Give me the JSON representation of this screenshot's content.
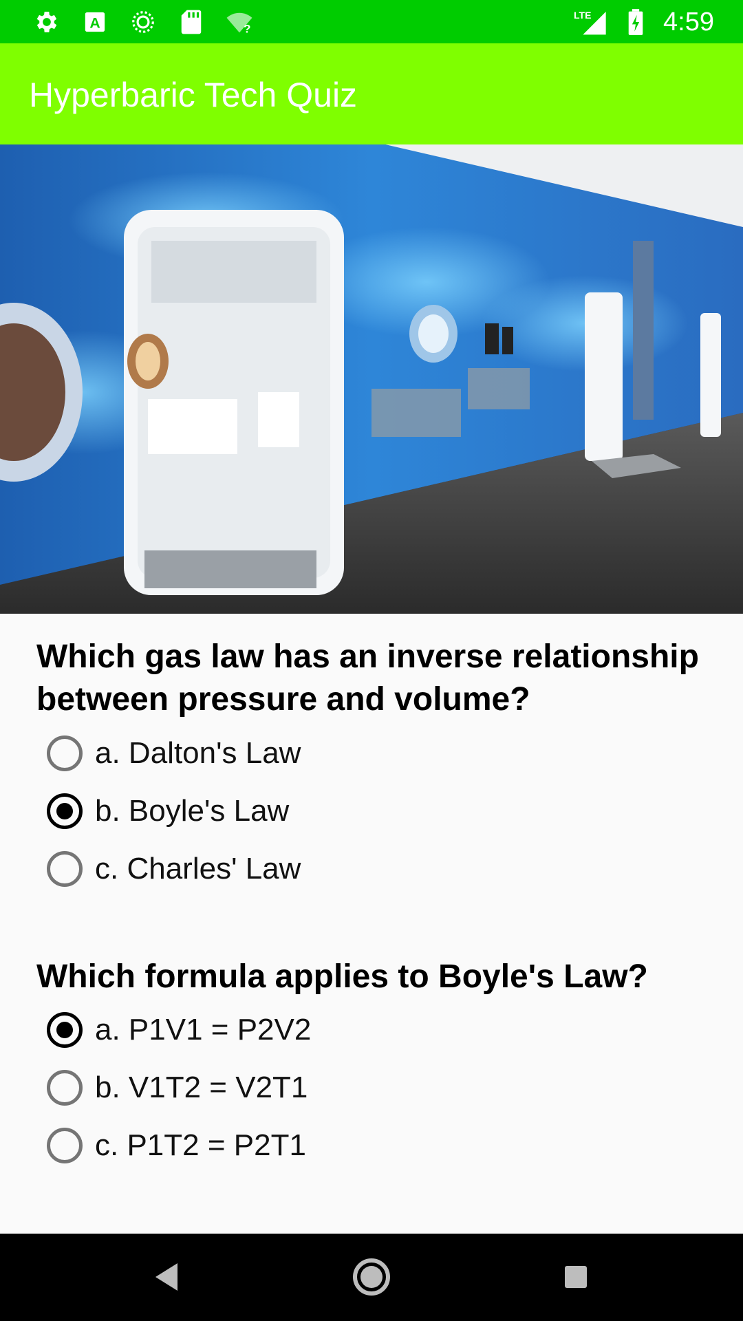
{
  "status_bar": {
    "left_icons": [
      "gear-icon",
      "a-icon",
      "sync-icon",
      "sd-card-icon",
      "wifi-question-icon"
    ],
    "network_label": "LTE",
    "time": "4:59"
  },
  "app_bar": {
    "title": "Hyperbaric Tech Quiz"
  },
  "hero_image": {
    "subject": "hyperbaric chamber corridor"
  },
  "questions": [
    {
      "text": "Which gas law has an inverse relationship between pressure and volume?",
      "options": [
        {
          "label": "a. Dalton's Law",
          "checked": false
        },
        {
          "label": "b. Boyle's Law",
          "checked": true
        },
        {
          "label": "c. Charles' Law",
          "checked": false
        }
      ]
    },
    {
      "text": "Which formula applies to Boyle's Law?",
      "options": [
        {
          "label": "a. P1V1 = P2V2",
          "checked": true
        },
        {
          "label": "b. V1T2 = V2T1",
          "checked": false
        },
        {
          "label": "c. P1T2 = P2T1",
          "checked": false
        }
      ]
    }
  ],
  "nav_bar": {
    "buttons": [
      "back-icon",
      "home-icon",
      "recents-icon"
    ]
  },
  "colors": {
    "status_bar": "#00cc00",
    "app_bar": "#7fff00",
    "background": "#fafafa"
  }
}
